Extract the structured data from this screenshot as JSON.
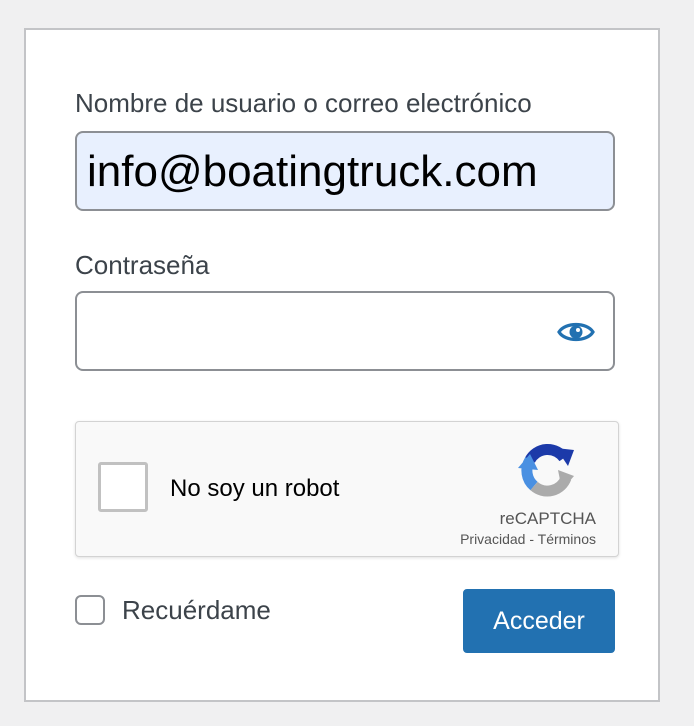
{
  "form": {
    "username_label": "Nombre de usuario o correo electrónico",
    "username_value": "info@boatingtruck.com",
    "password_label": "Contraseña",
    "password_value": "",
    "show_password_icon": "eye-icon",
    "remember_label": "Recuérdame",
    "remember_checked": false,
    "submit_label": "Acceder"
  },
  "recaptcha": {
    "label": "No soy un robot",
    "checked": false,
    "brand": "reCAPTCHA",
    "privacy_link": "Privacidad",
    "separator": "-",
    "terms_link": "Términos"
  },
  "colors": {
    "accent": "#2271b1",
    "autofill_bg": "#e8f0fe",
    "page_bg": "#f0f0f1",
    "text": "#3c434a"
  }
}
